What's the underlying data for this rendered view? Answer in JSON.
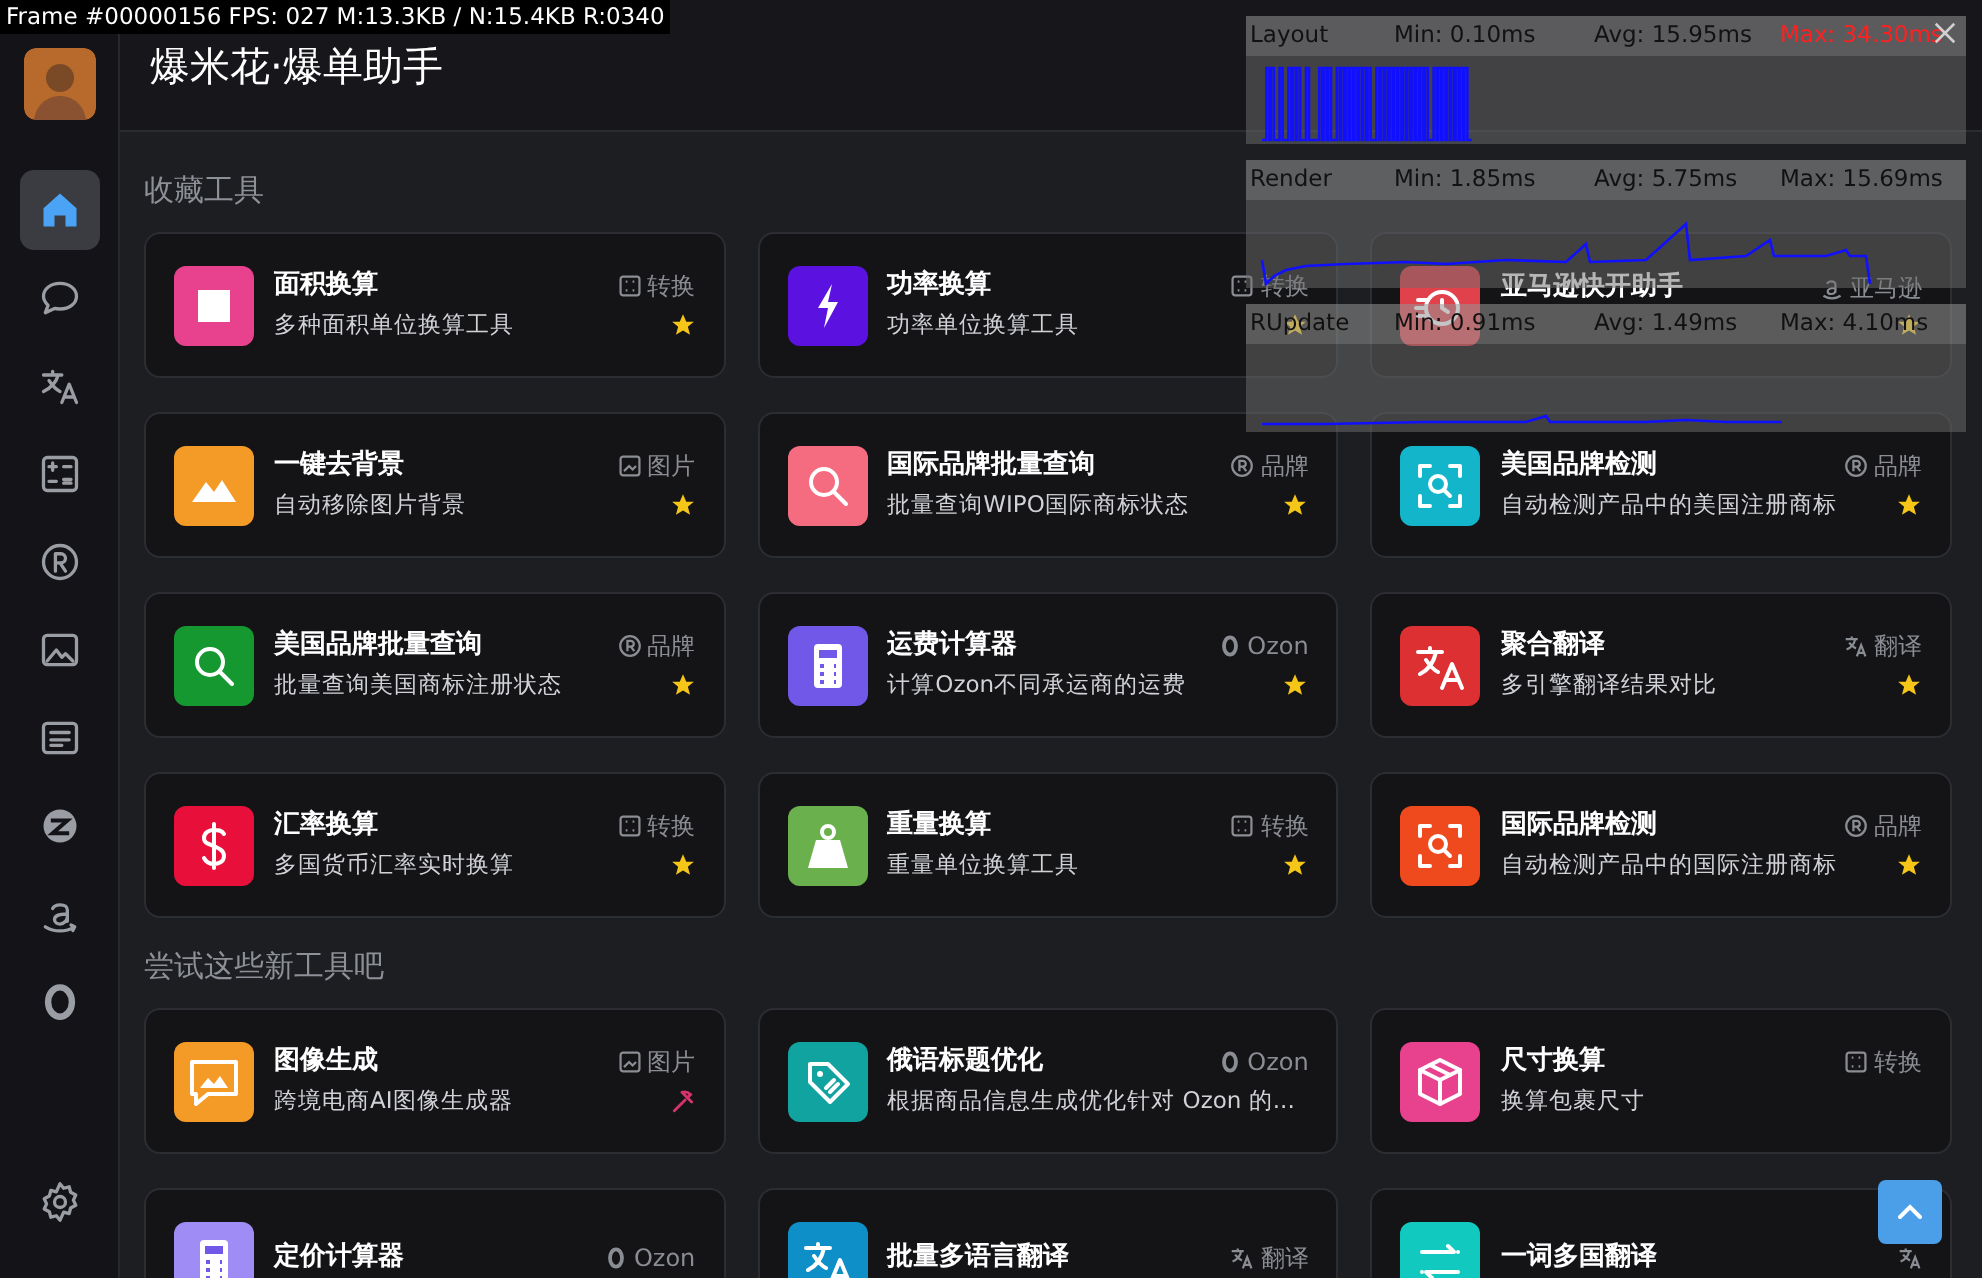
{
  "debug_stats": "Frame #00000156 FPS: 027 M:13.3KB / N:15.4KB R:0340",
  "header": {
    "title": "爆米花·爆单助手"
  },
  "sidebar": {
    "items": [
      {
        "kind": "home",
        "selected": true
      },
      {
        "kind": "chat",
        "selected": false
      },
      {
        "kind": "translate",
        "selected": false
      },
      {
        "kind": "calculator",
        "selected": false
      },
      {
        "kind": "registered",
        "selected": false
      },
      {
        "kind": "image",
        "selected": false
      },
      {
        "kind": "text",
        "selected": false
      },
      {
        "kind": "zcircle",
        "selected": false
      },
      {
        "kind": "amazon",
        "selected": false
      },
      {
        "kind": "ozon",
        "selected": false
      }
    ],
    "footer": {
      "kind": "settings"
    }
  },
  "sections": [
    {
      "title": "收藏工具",
      "cards": [
        {
          "kind": "square",
          "color": "#e8418e",
          "title": "面积换算",
          "description": "多种面积单位换算工具",
          "tag": {
            "kind": "convert",
            "label": "转换"
          },
          "favorite": true,
          "hot": false
        },
        {
          "kind": "bolt",
          "color": "#5b12e0",
          "title": "功率换算",
          "description": "功率单位换算工具",
          "tag": {
            "kind": "convert",
            "label": "转换"
          },
          "favorite": true,
          "hot": false
        },
        {
          "kind": "clock",
          "color": "#e0414a",
          "title": "亚马逊快开助手",
          "tag": {
            "kind": "amazon",
            "label": "亚马逊"
          },
          "favorite": true,
          "hot": false
        },
        {
          "kind": "mountains",
          "color": "#f39a27",
          "title": "一键去背景",
          "description": "自动移除图片背景",
          "tag": {
            "kind": "image",
            "label": "图片"
          },
          "favorite": true,
          "hot": false
        },
        {
          "kind": "search",
          "color": "#f56c80",
          "title": "国际品牌批量查询",
          "description": "批量查询WIPO国际商标状态",
          "tag": {
            "kind": "brand",
            "label": "品牌"
          },
          "favorite": true,
          "hot": false
        },
        {
          "kind": "scan",
          "color": "#12b5c9",
          "title": "美国品牌检测",
          "description": "自动检测产品中的美国注册商标",
          "tag": {
            "kind": "brand",
            "label": "品牌"
          },
          "favorite": true,
          "hot": false
        },
        {
          "kind": "search",
          "color": "#14982f",
          "title": "美国品牌批量查询",
          "description": "批量查询美国商标注册状态",
          "tag": {
            "kind": "brand",
            "label": "品牌"
          },
          "favorite": true,
          "hot": false
        },
        {
          "kind": "calculator",
          "color": "#7158e8",
          "title": "运费计算器",
          "description": "计算Ozon不同承运商的运费",
          "tag": {
            "kind": "ozon",
            "label": "Ozon"
          },
          "favorite": true,
          "hot": false
        },
        {
          "kind": "translate",
          "color": "#dc3033",
          "title": "聚合翻译",
          "description": "多引擎翻译结果对比",
          "tag": {
            "kind": "translate",
            "label": "翻译"
          },
          "favorite": true,
          "hot": false
        },
        {
          "kind": "dollar",
          "color": "#e8103a",
          "title": "汇率换算",
          "description": "多国货币汇率实时换算",
          "tag": {
            "kind": "convert",
            "label": "转换"
          },
          "favorite": true,
          "hot": false
        },
        {
          "kind": "weight",
          "color": "#6ab04c",
          "title": "重量换算",
          "description": "重量单位换算工具",
          "tag": {
            "kind": "convert",
            "label": "转换"
          },
          "favorite": true,
          "hot": false
        },
        {
          "kind": "scan",
          "color": "#ee4a1e",
          "title": "国际品牌检测",
          "description": "自动检测产品中的国际注册商标",
          "tag": {
            "kind": "brand",
            "label": "品牌"
          },
          "favorite": true,
          "hot": false
        }
      ]
    },
    {
      "title": "尝试这些新工具吧",
      "cards": [
        {
          "kind": "imagechat",
          "color": "#f39a27",
          "title": "图像生成",
          "description": "跨境电商AI图像生成器",
          "tag": {
            "kind": "image",
            "label": "图片"
          },
          "favorite": false,
          "hot": true
        },
        {
          "kind": "tag",
          "color": "#10a3a0",
          "title": "俄语标题优化",
          "description": "根据商品信息生成优化针对 Ozon 的...",
          "tag": {
            "kind": "ozon",
            "label": "Ozon"
          },
          "favorite": false,
          "hot": false
        },
        {
          "kind": "box",
          "color": "#e8418e",
          "title": "尺寸换算",
          "description": "换算包裹尺寸",
          "tag": {
            "kind": "convert",
            "label": "转换"
          },
          "favorite": false,
          "hot": false
        },
        {
          "kind": "calculator",
          "color": "#a08cf5",
          "title": "定价计算器",
          "tag": {
            "kind": "ozon",
            "label": "Ozon"
          },
          "favorite": false,
          "hot": false
        },
        {
          "kind": "translate",
          "color": "#0f8fc8",
          "title": "批量多语言翻译",
          "tag": {
            "kind": "translate",
            "label": "翻译"
          },
          "favorite": false,
          "hot": false
        },
        {
          "kind": "arrows",
          "color": "#12c9c0",
          "title": "一词多国翻译",
          "tag": {
            "kind": "translate"
          },
          "favorite": false,
          "hot": false
        }
      ]
    }
  ],
  "perf_overlay": [
    {
      "label": "Layout",
      "min": "Min:  0.10ms",
      "avg": "Avg: 15.95ms",
      "max": "Max: 34.30ms",
      "max_alert": true
    },
    {
      "label": "Render",
      "min": "Min:  1.85ms",
      "avg": "Avg:  5.75ms",
      "max": "Max: 15.69ms",
      "max_alert": false
    },
    {
      "label": "RUpdate",
      "min": "Min:  0.91ms",
      "avg": "Avg:  1.49ms",
      "max": "Max:  4.10ms",
      "max_alert": false
    }
  ]
}
